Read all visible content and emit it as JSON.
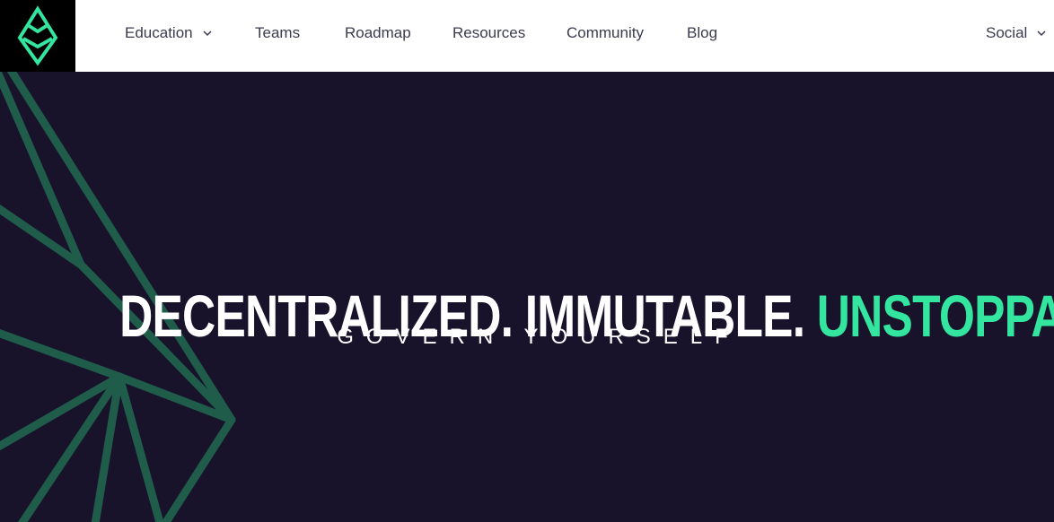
{
  "brand": {
    "logo_icon": "etc-diamond-logo-icon",
    "logo_color": "#33e59e"
  },
  "nav": {
    "education": "Education",
    "teams": "Teams",
    "roadmap": "Roadmap",
    "resources": "Resources",
    "community": "Community",
    "blog": "Blog",
    "social": "Social"
  },
  "hero": {
    "headline_white": "DECENTRALIZED. IMMUTABLE.",
    "headline_accent": "UNSTOPPABLE.",
    "tagline": "GOVERN YOURSELF",
    "accent_color": "#33e59e",
    "background_color": "#18122b",
    "graphic_line_color": "#1f5c4a"
  }
}
